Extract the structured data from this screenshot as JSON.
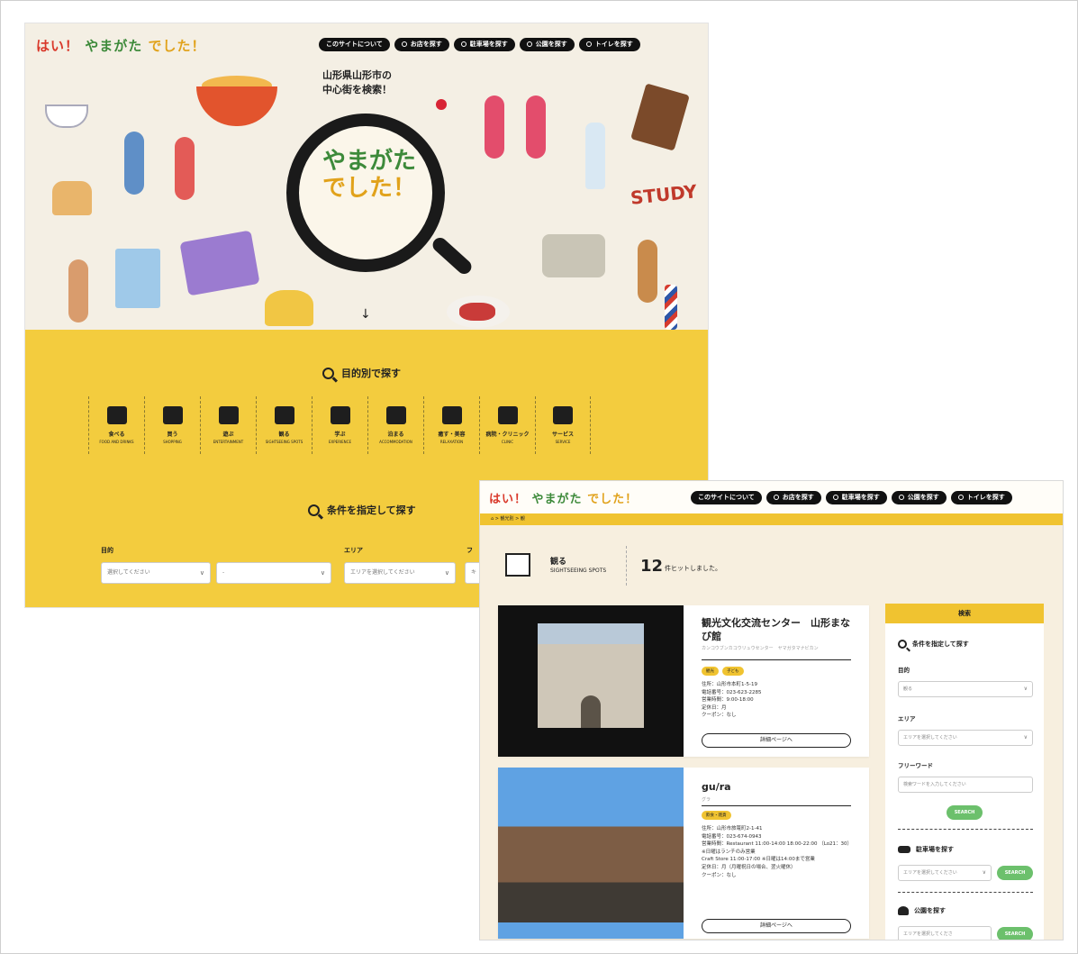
{
  "common": {
    "logo": {
      "parts": [
        "はい！",
        "やまがた",
        "でした！"
      ],
      "colors": [
        "#d9382a",
        "#3d8a3a",
        "#e1a21b"
      ]
    },
    "nav": [
      "このサイトについて",
      "お店を探す",
      "駐車場を探す",
      "公園を探す",
      "トイレを探す"
    ]
  },
  "screen1": {
    "catch": [
      "山形県山形市の",
      "中心街を検索！"
    ],
    "lens_text": [
      "やまがた",
      "でした！"
    ],
    "study_text": "STUDY",
    "purpose_title": "目的別で探す",
    "categories": [
      {
        "ja": "食べる",
        "en": "FOOD AND DRINKS",
        "icon": "plate-icon"
      },
      {
        "ja": "買う",
        "en": "SHOPPING",
        "icon": "bag-icon"
      },
      {
        "ja": "遊ぶ",
        "en": "ENTERTAINMENT",
        "icon": "film-icon"
      },
      {
        "ja": "観る",
        "en": "SIGHTSEEING SPOTS",
        "icon": "frame-icon"
      },
      {
        "ja": "学ぶ",
        "en": "EXPERIENCE",
        "icon": "graduation-icon"
      },
      {
        "ja": "泊まる",
        "en": "ACCOMMODATION",
        "icon": "building-icon"
      },
      {
        "ja": "癒す・美容",
        "en": "RELAXATION",
        "icon": "relax-icon"
      },
      {
        "ja": "病院・クリニック",
        "en": "CLINIC",
        "icon": "nurse-icon"
      },
      {
        "ja": "サービス",
        "en": "SERVICE",
        "icon": "service-icon"
      }
    ],
    "condition_title": "条件を指定して探す",
    "purpose_label": "目的",
    "area_label": "エリア",
    "free_label": "フ",
    "select1": "選択してください",
    "select2": "-",
    "select3": "エリアを選択してください",
    "select4": "キ"
  },
  "screen2": {
    "breadcrumb": "⌂ > 観光別 > 観",
    "category_name": "観る",
    "category_en": "SIGHTSEEING SPOTS",
    "hit_count": "12",
    "hit_text": "件ヒットしました。",
    "results": [
      {
        "title": "観光文化交流センター　山形まなび館",
        "kana": "カンコウブンカコウリュウセンター　ヤマガタマナビカン",
        "tags": [
          "観光",
          "子ども"
        ],
        "info": [
          "住所：山形市本町1-5-19",
          "電話番号：023-623-2285",
          "営業時間：9:00-18:00",
          "定休日：月",
          "クーポン：なし"
        ],
        "detail": "詳細ページへ"
      },
      {
        "title": "gu/ra",
        "kana": "グラ",
        "tags": [
          "飲食・雑貨"
        ],
        "info": [
          "住所：山形市旅篭町2-1-41",
          "電話番号：023-674-0943",
          "営業時間：Restaurant 11:00-14:00 18:00-22:00 （Lo21：30）※日曜はランチのみ営業",
          "Craft Store 11:00-17:00 ※日曜は14:00まで営業",
          "定休日：月（月曜祝日の場合、翌火曜休）",
          "クーポン：なし"
        ],
        "detail": "詳細ページへ"
      }
    ],
    "sidebar": {
      "head": "検索",
      "cond_title": "条件を指定して探す",
      "purpose_label": "目的",
      "purpose_value": "観る",
      "area_label": "エリア",
      "area_placeholder": "エリアを選択してください",
      "free_label": "フリーワード",
      "free_placeholder": "検索ワードを入力してください",
      "search": "SEARCH",
      "parking_title": "駐車場を探す",
      "parking_placeholder": "エリアを選択してください",
      "park_title": "公園を探す",
      "park_placeholder": "エリアを選択してくださ"
    }
  }
}
